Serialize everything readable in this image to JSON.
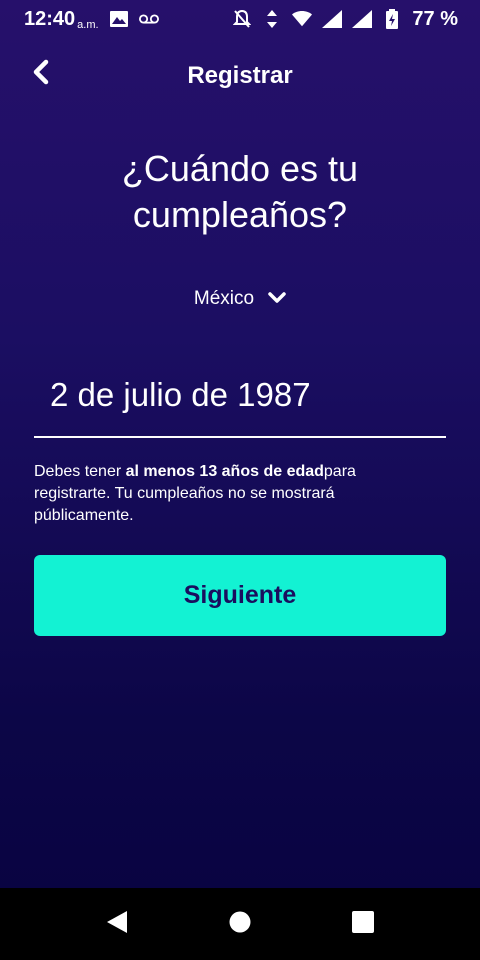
{
  "status_bar": {
    "time": "12:40",
    "ampm": "a.m.",
    "battery": "77 %"
  },
  "header": {
    "title": "Registrar"
  },
  "main": {
    "question": "¿Cuándo es tu cumpleaños?",
    "country": "México",
    "birthday_value": "2 de julio de 1987",
    "note_prefix": "Debes tener ",
    "note_bold": "al menos 13 años de edad",
    "note_suffix": "para registrarte. Tu cumpleaños no se mostrará públicamente.",
    "next_label": "Siguiente"
  },
  "colors": {
    "accent": "#13f2d3",
    "button_text": "#1a0e5e",
    "background_top": "#26106b",
    "background_bottom": "#080340"
  }
}
